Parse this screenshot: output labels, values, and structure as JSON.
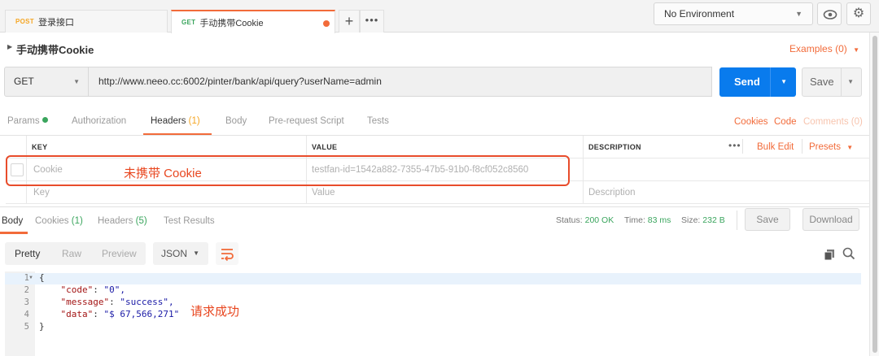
{
  "tabs": [
    {
      "method": "POST",
      "title": "登录接口"
    },
    {
      "method": "GET",
      "title": "手动携带Cookie"
    }
  ],
  "tab_more": "•••",
  "environment": "No Environment",
  "request_name": "手动携带Cookie",
  "examples_link": "Examples (0)",
  "method": "GET",
  "url": "http://www.neeo.cc:6002/pinter/bank/api/query?userName=admin",
  "send_label": "Send",
  "save_label": "Save",
  "request_tabs": {
    "params": "Params",
    "authorization": "Authorization",
    "headers": "Headers",
    "headers_count": "(1)",
    "body": "Body",
    "prerequest": "Pre-request Script",
    "tests": "Tests",
    "cookies": "Cookies",
    "code": "Code",
    "comments": "Comments (0)"
  },
  "headers_table": {
    "col_key": "KEY",
    "col_value": "VALUE",
    "col_description": "DESCRIPTION",
    "dots": "•••",
    "bulk_edit": "Bulk Edit",
    "presets": "Presets",
    "row": {
      "key": "Cookie",
      "value": "testfan-id=1542a882-7355-47b5-91b0-f8cf052c8560"
    },
    "placeholders": {
      "key": "Key",
      "value": "Value",
      "description": "Description"
    }
  },
  "annotations": {
    "no_cookie": "未携带 Cookie",
    "success": "请求成功"
  },
  "response": {
    "tabs": {
      "body": "Body",
      "cookies": "Cookies",
      "cookies_count": "(1)",
      "headers": "Headers",
      "headers_count": "(5)",
      "test_results": "Test Results"
    },
    "status_label": "Status:",
    "status_value": "200 OK",
    "time_label": "Time:",
    "time_value": "83 ms",
    "size_label": "Size:",
    "size_value": "232 B",
    "save": "Save",
    "download": "Download",
    "formats": {
      "pretty": "Pretty",
      "raw": "Raw",
      "preview": "Preview"
    },
    "language": "JSON",
    "body_lines": [
      {
        "n": "1",
        "text": "{"
      },
      {
        "n": "2",
        "key": "\"code\"",
        "value": "\"0\","
      },
      {
        "n": "3",
        "key": "\"message\"",
        "value": "\"success\","
      },
      {
        "n": "4",
        "key": "\"data\"",
        "value": "\"$ 67,566,271\""
      },
      {
        "n": "5",
        "text": "}"
      }
    ]
  },
  "colors": {
    "accent": "#f26b3a",
    "send_blue": "#097bed",
    "success_green": "#3aa55d",
    "annotation_red": "#e84c2b"
  }
}
